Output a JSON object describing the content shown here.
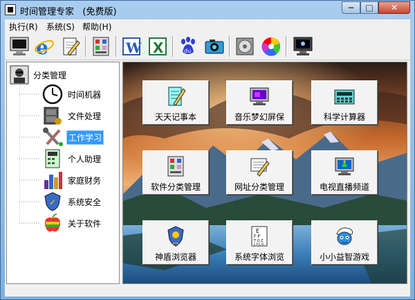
{
  "window": {
    "title": "时间管理专家   (免费版)",
    "minimize": "−",
    "maximize": "□",
    "close": "✕"
  },
  "menu": [
    {
      "label": "执行(R)"
    },
    {
      "label": "系统(S)"
    },
    {
      "label": "帮助(H)"
    }
  ],
  "toolbar": [
    {
      "icon": "monitor-icon"
    },
    {
      "icon": "ie-browser-icon"
    },
    {
      "icon": "notepad-pencil-icon"
    },
    {
      "icon": "software-category-icon"
    },
    {
      "icon": "word-icon"
    },
    {
      "icon": "excel-icon"
    },
    {
      "icon": "baidu-paw-icon"
    },
    {
      "icon": "camera-icon"
    },
    {
      "icon": "disc-player-icon"
    },
    {
      "icon": "color-wheel-icon"
    },
    {
      "icon": "screensaver-monitor-icon"
    }
  ],
  "tree": {
    "root": "分类管理",
    "items": [
      {
        "label": "时间机器",
        "icon": "clock-icon"
      },
      {
        "label": "文件处理",
        "icon": "file-cabinet-icon"
      },
      {
        "label": "工作学习",
        "icon": "tools-icon",
        "selected": true
      },
      {
        "label": "个人助理",
        "icon": "calculator-icon"
      },
      {
        "label": "家庭财务",
        "icon": "bar-chart-icon"
      },
      {
        "label": "系统安全",
        "icon": "security-shield-icon"
      },
      {
        "label": "关于软件",
        "icon": "apple-icon"
      }
    ]
  },
  "tiles": [
    {
      "label": "天天记事本",
      "icon": "notebook-icon"
    },
    {
      "label": "音乐梦幻屏保",
      "icon": "music-screen-icon"
    },
    {
      "label": "科学计算器",
      "icon": "scientific-calculator-icon"
    },
    {
      "label": "软件分类管理",
      "icon": "software-manager-icon"
    },
    {
      "label": "网址分类管理",
      "icon": "web-address-icon"
    },
    {
      "label": "电视直播频道",
      "icon": "tv-icon"
    },
    {
      "label": "神盾浏览器",
      "icon": "shield-browser-icon"
    },
    {
      "label": "系统字体浏览",
      "icon": "font-chart-icon"
    },
    {
      "label": "小小益智游戏",
      "icon": "smurf-game-icon"
    }
  ]
}
